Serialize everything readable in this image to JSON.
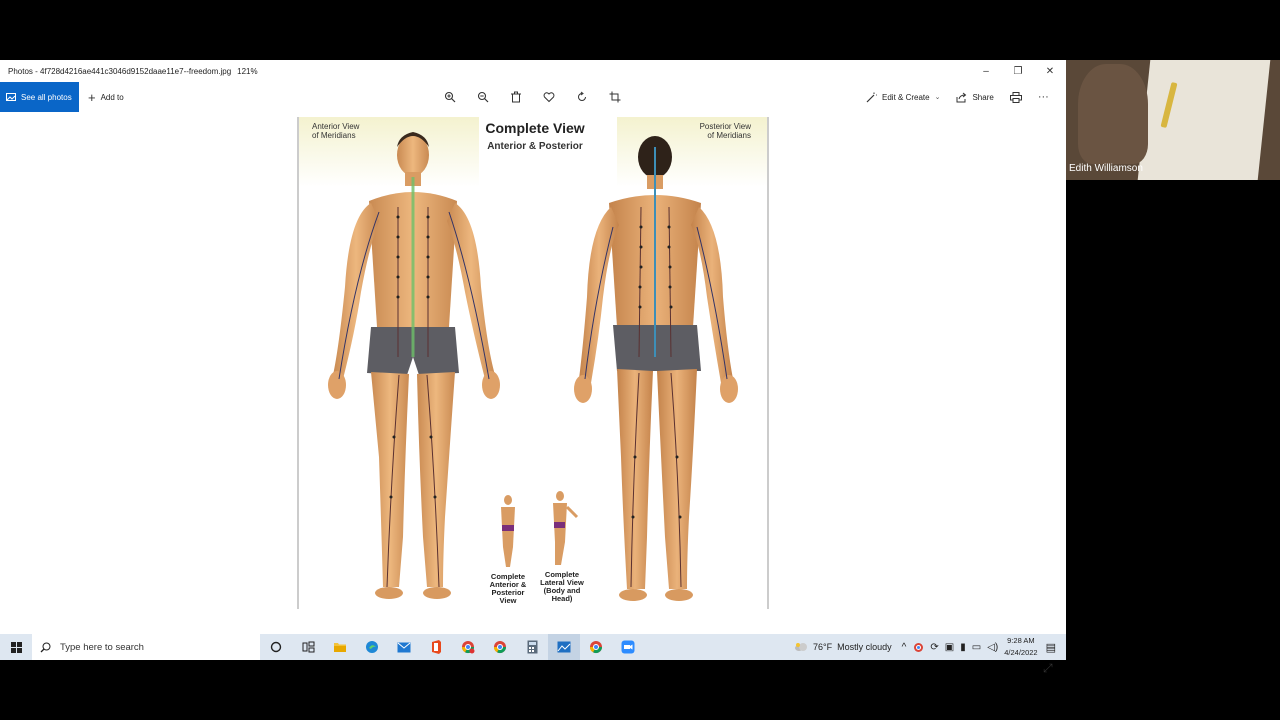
{
  "window": {
    "title": "Photos - 4f728d4216ae441c3046d9152daae11e7--freedom.jpg",
    "zoom": "121%",
    "controls": {
      "minimize": "–",
      "restore": "❐",
      "close": "✕"
    }
  },
  "toolbar": {
    "see_all_label": "See all photos",
    "add_to_label": "Add to",
    "edit_create_label": "Edit & Create",
    "share_label": "Share",
    "center_icons": [
      "zoom-in-icon",
      "zoom-out-icon",
      "delete-icon",
      "favorite-icon",
      "rotate-icon",
      "crop-icon"
    ],
    "right_icons": [
      "edit-create-icon",
      "share-icon",
      "print-icon",
      "more-icon"
    ]
  },
  "poster": {
    "title": "Complete View",
    "subtitle": "Anterior & Posterior",
    "anterior_label_1": "Anterior View",
    "anterior_label_2": "of Meridians",
    "posterior_label_1": "Posterior View",
    "posterior_label_2": "of Meridians",
    "caption_front_1": "Complete",
    "caption_front_2": "Anterior &",
    "caption_front_3": "Posterior",
    "caption_front_4": "View",
    "caption_side_1": "Complete",
    "caption_side_2": "Lateral View",
    "caption_side_3": "(Body and",
    "caption_side_4": "Head)"
  },
  "webcam": {
    "participant_name": "Edith Williamson"
  },
  "taskbar": {
    "search_placeholder": "Type here to search",
    "pinned_icons": [
      "cortana-icon",
      "task-view-icon",
      "file-explorer-icon",
      "edge-icon",
      "mail-icon",
      "office-icon",
      "chrome-icon",
      "chrome-icon",
      "calculator-icon",
      "photos-icon",
      "chrome-icon",
      "zoom-icon"
    ],
    "weather_temp": "76°F",
    "weather_desc": "Mostly cloudy",
    "time": "9:28 AM",
    "date": "4/24/2022"
  },
  "colors": {
    "accent": "#0a66c8",
    "taskbar": "#dee7f1",
    "skin": "#e3a86c"
  }
}
